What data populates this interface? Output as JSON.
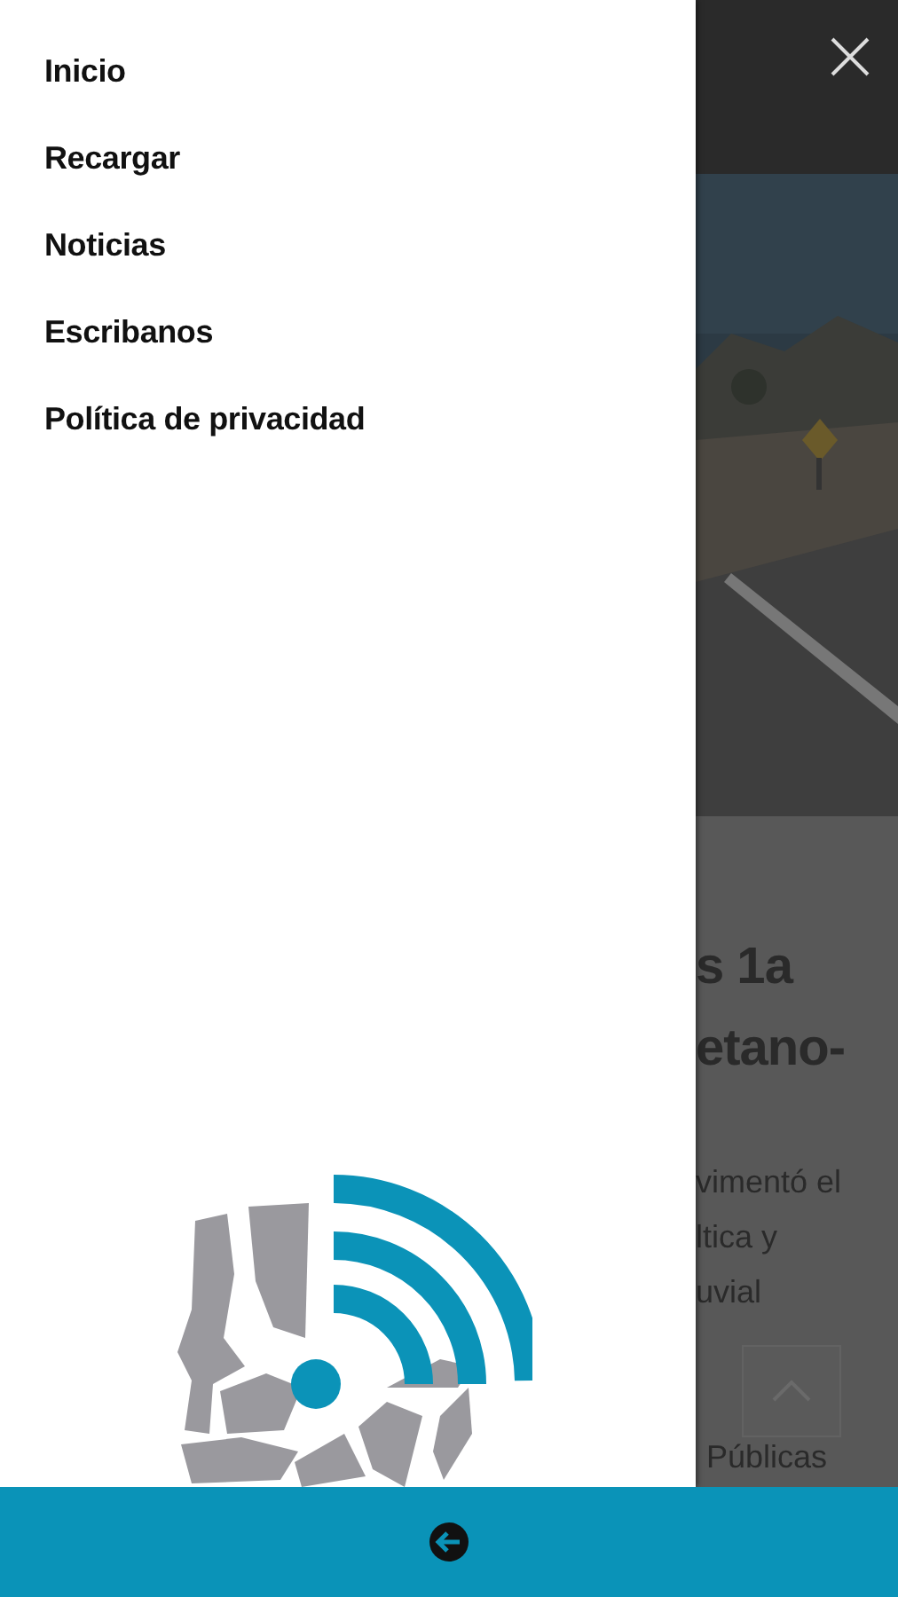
{
  "drawer": {
    "items": [
      {
        "label": "Inicio"
      },
      {
        "label": "Recargar"
      },
      {
        "label": "Noticias"
      },
      {
        "label": "Escribanos"
      },
      {
        "label": "Política de privacidad"
      }
    ]
  },
  "background_article": {
    "image": {
      "kind": "picture"
    },
    "headline_lines": [
      "s 1a",
      "etano-"
    ],
    "body_lines": [
      "vimentó el",
      "ltica y",
      "uvial"
    ],
    "footer_text": "Públicas"
  }
}
